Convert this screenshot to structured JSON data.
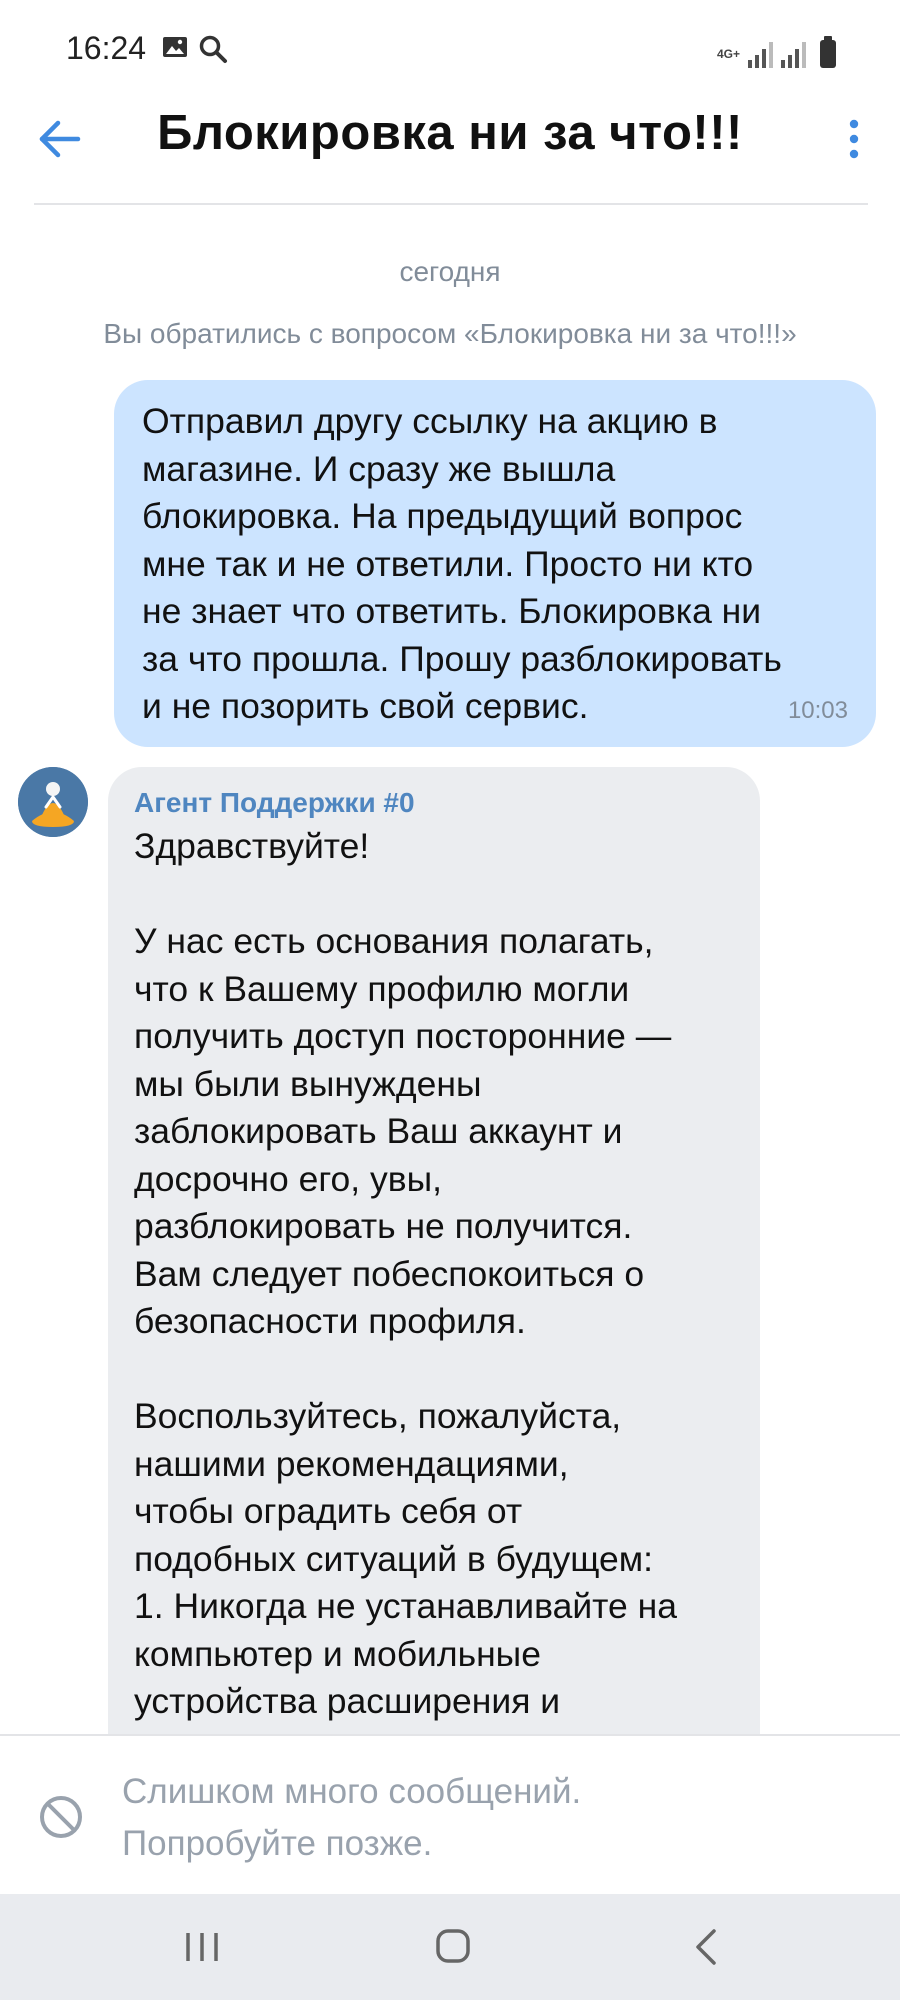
{
  "status_bar": {
    "time": "16:24",
    "network": "4G+",
    "icons": [
      "gallery-icon",
      "search-icon",
      "signal-icon",
      "battery-icon"
    ]
  },
  "header": {
    "title": "Блокировка ни за что!!!",
    "back_icon": "arrow-left-icon",
    "more_icon": "more-vertical-icon"
  },
  "chat": {
    "date_separator": "сегодня",
    "system_message": "Вы обратились с вопросом «Блокировка ни за что!!!»",
    "outgoing": {
      "text": "Отправил другу ссылку на акцию в\nмагазине. И сразу же вышла\nблокировка. На предыдущий вопрос\nмне так и не ответили. Просто ни кто\nне знает что ответить. Блокировка ни\nза что прошла. Прошу разблокировать\nи не позорить свой сервис.",
      "time": "10:03"
    },
    "incoming": {
      "author": "Агент Поддержки #0",
      "text": "Здравствуйте!\n\nУ нас есть основания полагать,\nчто к Вашему профилю могли\nполучить доступ посторонние —\nмы были вынуждены\nзаблокировать Ваш аккаунт и\nдосрочно его, увы,\nразблокировать не получится.\nВам следует побеспокоиться о\nбезопасности профиля.\n\nВоспользуйтесь, пожалуйста,\nнашими рекомендациями,\nчтобы оградить себя от\nподобных ситуаций в будущем:\n1. Никогда не устанавливайте на\nкомпьютер и мобильные\nустройства расширения и"
    }
  },
  "composer": {
    "notice": "Слишком много сообщений.\nПопробуйте позже.",
    "icon": "blocked-icon"
  },
  "nav": {
    "icons": [
      "recent-apps-icon",
      "home-icon",
      "back-icon"
    ]
  },
  "colors": {
    "outgoing_bubble": "#cce4ff",
    "incoming_bubble": "#ebedf0",
    "accent": "#4f86c0",
    "muted_text": "#818c99",
    "nav_bar": "#e9ebef"
  }
}
